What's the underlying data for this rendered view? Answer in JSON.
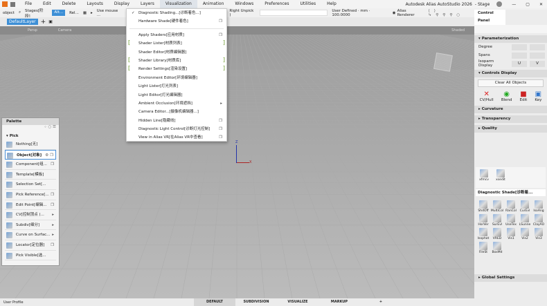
{
  "app": {
    "title": "Autodesk Alias AutoStudio 2026",
    "stage": "- Stage"
  },
  "menu": [
    "File",
    "Edit",
    "Delete",
    "Layouts",
    "Display",
    "Layers",
    "Visualization",
    "Animation",
    "Windows",
    "Preferences",
    "Utilities",
    "Help"
  ],
  "toolbar": {
    "pick": "object",
    "stages": "Stages[阶段]",
    "alt": "Alt...",
    "rel": "Rel...",
    "hint": "Use mouse ...",
    "hint_end": "Right Unpick )",
    "units": "User Defined · mm · 100.0000",
    "renderer": "Alias Renderer"
  },
  "layer": {
    "name": "DefaultLayer"
  },
  "viewport": {
    "view": "Persp",
    "camera": "Camera",
    "shading": "Shaded",
    "axes": {
      "z": "Z",
      "x": "X"
    }
  },
  "visualization_menu": [
    {
      "label": "Diagnostic Shading...[诊断着色...]",
      "check": "✓"
    },
    {
      "label": "Hardware Shade[硬件着色]",
      "opt": "❐"
    },
    {
      "sep": true
    },
    {
      "label": "Apply Shaders[应用材质]",
      "opt": "❐"
    },
    {
      "label": "Shader Lister[材质列表]",
      "bracket": true
    },
    {
      "label": "Shader Editor[材质编辑器]"
    },
    {
      "label": "Shader Library[材质库]",
      "bracket": true
    },
    {
      "label": "Render Settings[渲染设置]",
      "bracket": true
    },
    {
      "label": "Environment Editor[环境编辑器]"
    },
    {
      "label": "Light Lister[灯光列表]"
    },
    {
      "label": "Light Editor[灯光编辑器]"
    },
    {
      "label": "Ambient Occlusion[环境遮挡]",
      "opt": "▸"
    },
    {
      "label": "Camera Editor...[摄像机编辑器...]"
    },
    {
      "label": "Hidden Line[隐藏线]",
      "opt": "❐"
    },
    {
      "label": "Diagnostic Light Control[诊断灯光控制]",
      "opt": "❐"
    },
    {
      "label": "View in Alias VR[在Alias VR中查看]",
      "opt": "❐"
    }
  ],
  "palette": {
    "title": "Palette",
    "section": "Pick",
    "items": [
      {
        "label": "Nothing[无]"
      },
      {
        "label": "Object[对象]",
        "opt": "⚙ ❐",
        "sel": true
      },
      {
        "label": "Component[组...",
        "opt": "❐"
      },
      {
        "label": "Template[模板]"
      },
      {
        "label": "Selection Set[..."
      },
      {
        "label": "Pick Reference[...",
        "opt": "❐"
      },
      {
        "label": "Edit Point[编辑...",
        "opt": "❐"
      },
      {
        "label": "CV[控制顶点 (...",
        "opt": "▸"
      },
      {
        "label": "Subdiv[细分]",
        "opt": "▸"
      },
      {
        "label": "Curve on Surfac...",
        "opt": "▸"
      },
      {
        "label": "Locator[定位器]",
        "opt": "❐"
      },
      {
        "label": "Pick Visible[选..."
      }
    ]
  },
  "control_panel": {
    "tab": "Control Panel",
    "parameterization": "Parameterization",
    "degree": "Degree",
    "spans": "Spans",
    "isoparm": "Isoparm Display",
    "u": "U",
    "v": "V",
    "controls_display": "Controls Display",
    "clear": "Clear All Objects",
    "controls": [
      "CV/Hull",
      "Blend",
      "Edit",
      "Key"
    ],
    "curvature": "Curvature",
    "transparency": "Transparency",
    "quality": "Quality",
    "shelf": [
      "xfmcv",
      "xsedit"
    ],
    "shade_tab": "Diagnostic Shade[诊断着...",
    "tiles": [
      "ShdOff",
      "MultiCol",
      "RanCol",
      "CurEvl",
      "IsoAng",
      "HorVer",
      "SurEvl",
      "UseTex",
      "LSunne",
      "ClayAO",
      "Isophot",
      "VRED",
      "Vis1",
      "Vis2",
      "Vis3",
      "FileSt",
      "BoxMd"
    ],
    "global": "Global Settings"
  },
  "status": {
    "profile": "User Profile",
    "tabs": [
      "DEFAULT",
      "SUBDIVISION",
      "VISUALIZE",
      "MARKUP",
      "+"
    ]
  }
}
